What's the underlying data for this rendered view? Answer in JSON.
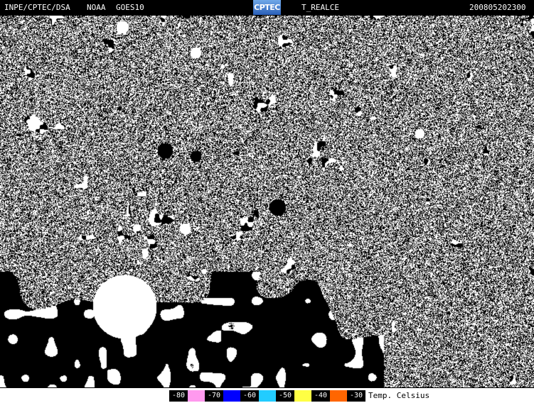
{
  "header": {
    "source": "INPE/CPTEC/DSA",
    "agency": "NOAA",
    "satellite": "GOES10",
    "logo_text": "CPTEC",
    "product": "T_REALCE",
    "timestamp": "200805202300"
  },
  "legend": {
    "items": [
      {
        "label": "-80",
        "color": "#ff99ee"
      },
      {
        "label": "-70",
        "color": "#0000ff"
      },
      {
        "label": "-60",
        "color": "#22ccff"
      },
      {
        "label": "-50",
        "color": "#ffff44"
      },
      {
        "label": "-40",
        "color": "#ff6600"
      },
      {
        "label": "-30",
        "color": "#000000"
      }
    ],
    "title": "Temp. Celsius"
  },
  "colors": {
    "background": "#000000",
    "cloud": "#ffffff"
  }
}
